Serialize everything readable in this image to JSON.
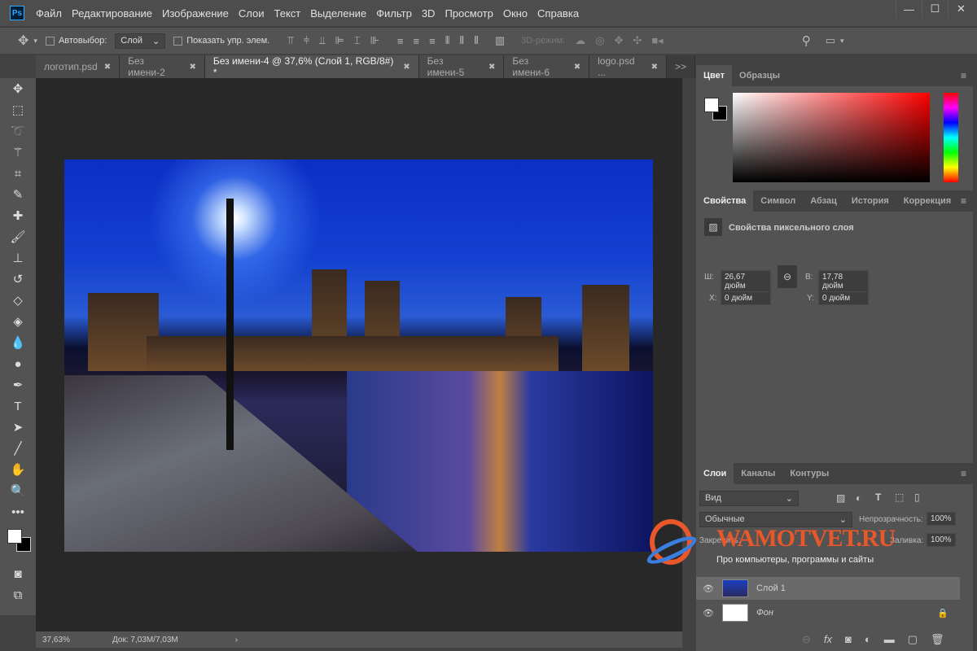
{
  "app": {
    "logo": "Ps"
  },
  "menu": [
    "Файл",
    "Редактирование",
    "Изображение",
    "Слои",
    "Текст",
    "Выделение",
    "Фильтр",
    "3D",
    "Просмотр",
    "Окно",
    "Справка"
  ],
  "window_controls": {
    "minimize": "—",
    "maximize": "☐",
    "close": "✕"
  },
  "options": {
    "auto_select_label": "Автовыбор:",
    "auto_select_value": "Слой",
    "show_controls_label": "Показать упр. элем.",
    "mode_3d_label": "3D-режим:"
  },
  "tabs": [
    {
      "label": "логотип.psd",
      "active": false
    },
    {
      "label": "Без имени-2",
      "active": false
    },
    {
      "label": "Без имени-4 @ 37,6% (Слой 1, RGB/8#) *",
      "active": true
    },
    {
      "label": "Без имени-5",
      "active": false
    },
    {
      "label": "Без имени-6",
      "active": false
    },
    {
      "label": "logo.psd ...",
      "active": false
    }
  ],
  "tabs_overflow": ">>",
  "status": {
    "zoom": "37,63%",
    "doc": "Док: 7,03M/7,03M",
    "arrow": "›"
  },
  "color_panel": {
    "tabs": [
      "Цвет",
      "Образцы"
    ],
    "fg": "#ffffff",
    "bg": "#000000",
    "hue": "#ff0000"
  },
  "properties_panel": {
    "tabs": [
      "Свойства",
      "Символ",
      "Абзац",
      "История",
      "Коррекция"
    ],
    "title": "Свойства пиксельного слоя",
    "w_label": "Ш:",
    "w_value": "26,67 дюйм",
    "h_label": "В:",
    "h_value": "17,78 дюйм",
    "x_label": "X:",
    "x_value": "0 дюйм",
    "y_label": "Y:",
    "y_value": "0 дюйм"
  },
  "layers_panel": {
    "tabs": [
      "Слои",
      "Каналы",
      "Контуры"
    ],
    "filter": "Вид",
    "blend": "Обычные",
    "opacity_label": "Непрозрачность:",
    "opacity": "100%",
    "lock_label": "Закрепить:",
    "fill_label": "Заливка:",
    "fill": "100%",
    "layers": [
      {
        "name": "Слой 1",
        "visible": true,
        "selected": true
      },
      {
        "name": "Фон",
        "visible": true,
        "locked": true
      }
    ]
  },
  "watermark": {
    "brand": "WAMOTVET.RU",
    "tagline": "Про компьютеры, программы и сайты"
  }
}
